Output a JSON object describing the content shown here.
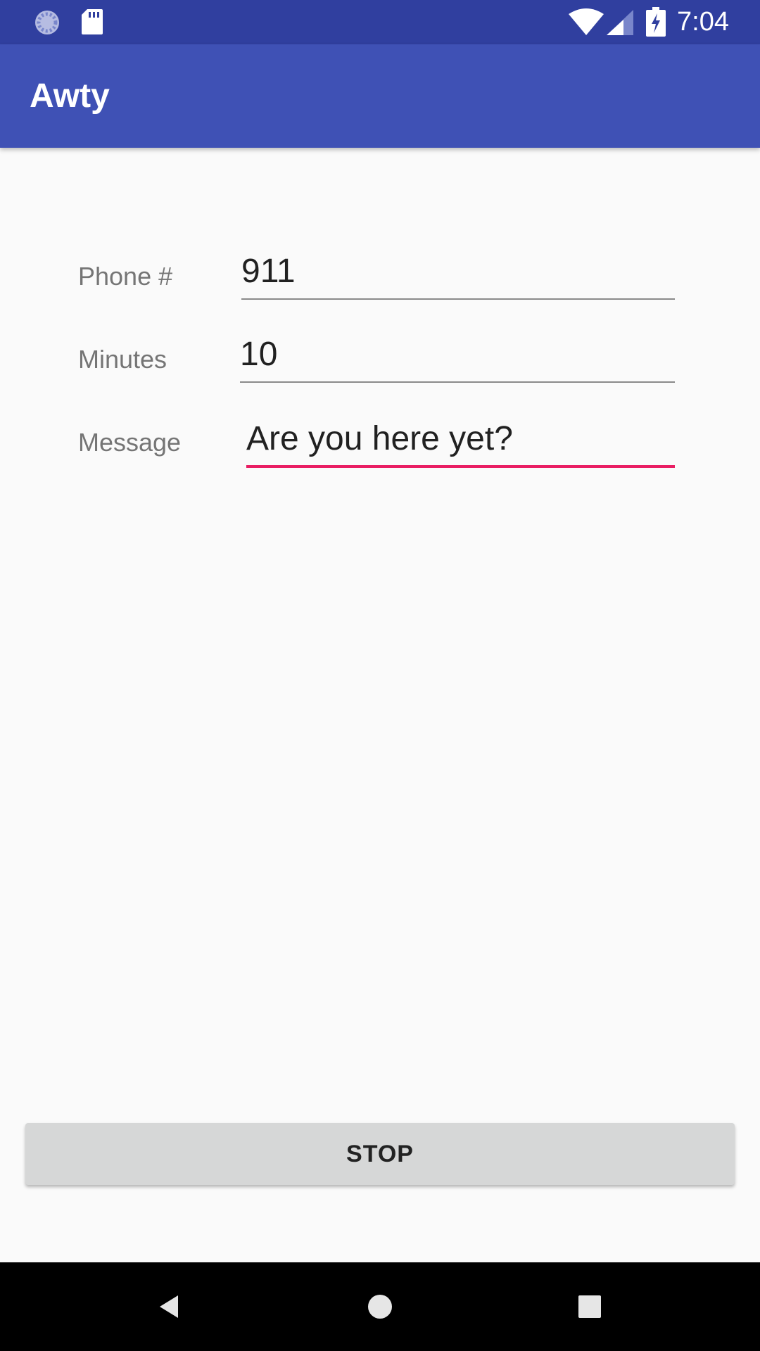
{
  "status_bar": {
    "time": "7:04",
    "icons": [
      "loader-icon",
      "sd-card-icon",
      "wifi-icon",
      "cell-signal-icon",
      "battery-charging-icon"
    ]
  },
  "app_bar": {
    "title": "Awty"
  },
  "form": {
    "phone": {
      "label": "Phone #",
      "value": "911"
    },
    "minutes": {
      "label": "Minutes",
      "value": "10"
    },
    "message": {
      "label": "Message",
      "value": "Are you here yet?",
      "focused": true
    }
  },
  "actions": {
    "stop_label": "STOP"
  },
  "nav_bar": {
    "icons": [
      "back-icon",
      "home-icon",
      "recents-icon"
    ]
  },
  "colors": {
    "status_bar": "#303f9f",
    "app_bar": "#3f51b5",
    "accent": "#e91e63",
    "background": "#fafafa",
    "button": "#d6d7d7"
  }
}
